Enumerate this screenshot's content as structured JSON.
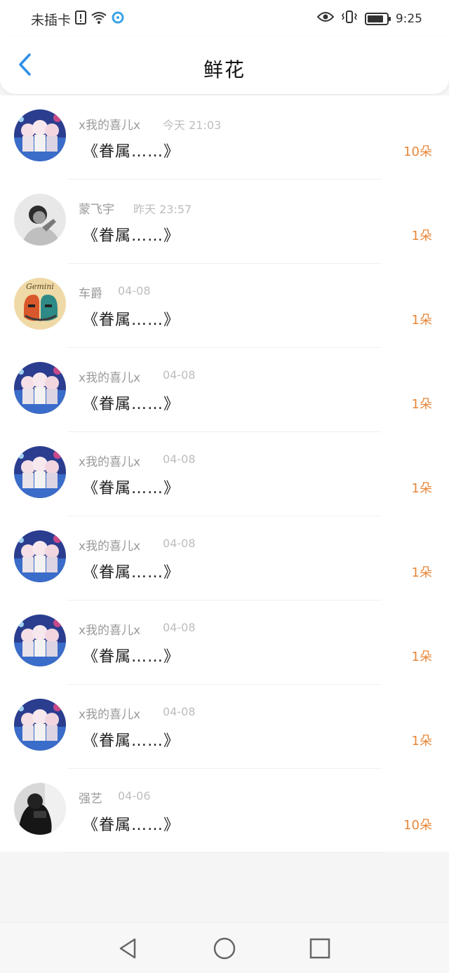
{
  "status_bar": {
    "carrier": "未插卡",
    "time": "9:25",
    "battery_level": 0.85,
    "icons": [
      "sim-alert-icon",
      "wifi-icon",
      "sync-icon",
      "eye-icon",
      "vibrate-icon",
      "battery-icon"
    ]
  },
  "header": {
    "title": "鲜花",
    "back_icon": "chevron-left-icon"
  },
  "colors": {
    "accent": "#2f8fe6",
    "count": "#e8873a",
    "name": "#9a9a9a",
    "time": "#bdbdbd"
  },
  "rows": [
    {
      "name": "x我的喜儿x",
      "time": "今天 21:03",
      "message": "《眷属……》",
      "count": "10朵",
      "avatar": "anime-group-avatar"
    },
    {
      "name": "蒙飞宇",
      "time": "昨天 23:57",
      "message": "《眷属……》",
      "count": "1朵",
      "avatar": "bw-portrait-avatar"
    },
    {
      "name": "车爵",
      "time": "04-08",
      "message": "《眷属……》",
      "count": "1朵",
      "avatar": "gemini-avatar"
    },
    {
      "name": "x我的喜儿x",
      "time": "04-08",
      "message": "《眷属……》",
      "count": "1朵",
      "avatar": "anime-group-avatar"
    },
    {
      "name": "x我的喜儿x",
      "time": "04-08",
      "message": "《眷属……》",
      "count": "1朵",
      "avatar": "anime-group-avatar"
    },
    {
      "name": "x我的喜儿x",
      "time": "04-08",
      "message": "《眷属……》",
      "count": "1朵",
      "avatar": "anime-group-avatar"
    },
    {
      "name": "x我的喜儿x",
      "time": "04-08",
      "message": "《眷属……》",
      "count": "1朵",
      "avatar": "anime-group-avatar"
    },
    {
      "name": "x我的喜儿x",
      "time": "04-08",
      "message": "《眷属……》",
      "count": "1朵",
      "avatar": "anime-group-avatar"
    },
    {
      "name": "强艺",
      "time": "04-06",
      "message": "《眷属……》",
      "count": "10朵",
      "avatar": "dark-photo-avatar"
    }
  ],
  "nav_bar": {
    "buttons": [
      "back-triangle-icon",
      "home-circle-icon",
      "recents-square-icon"
    ]
  }
}
